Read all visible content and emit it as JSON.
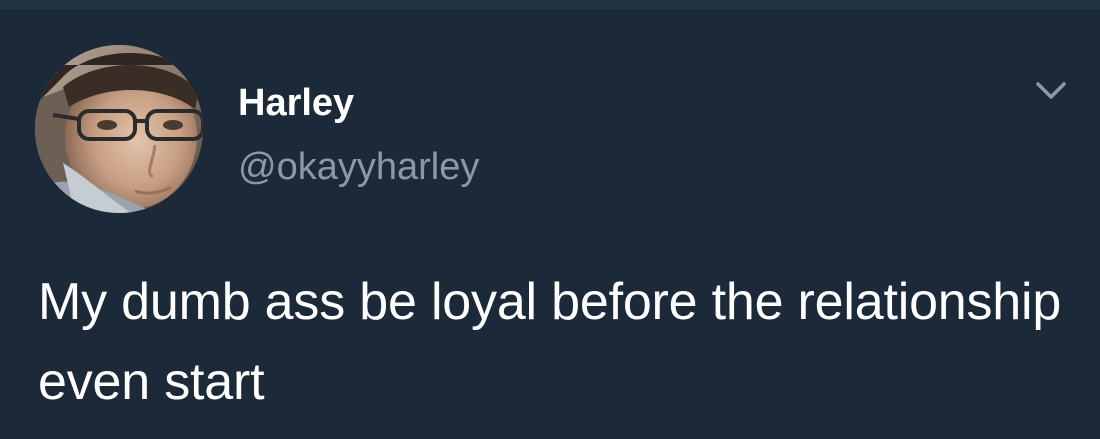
{
  "tweet": {
    "display_name": "Harley",
    "handle": "@okayyharley",
    "text": "My dumb ass be loyal before the relationship even start"
  },
  "icons": {
    "avatar": "profile-photo",
    "menu": "chevron-down-icon"
  },
  "colors": {
    "background": "#1c2938",
    "name": "#ffffff",
    "handle": "#8b98a6",
    "text": "#ffffff",
    "caret": "#8b98a6"
  }
}
